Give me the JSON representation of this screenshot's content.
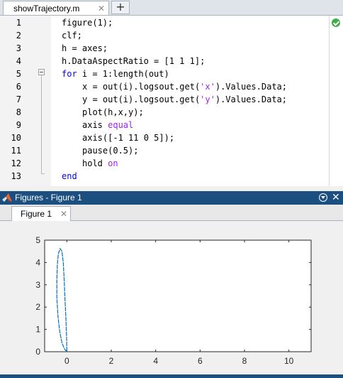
{
  "editor": {
    "tab_label": "showTrajectory.m",
    "new_tab_symbol": "+",
    "lines": [
      {
        "n": "1",
        "indent": 0,
        "parts": [
          {
            "t": "figure(1);",
            "c": "n"
          }
        ]
      },
      {
        "n": "2",
        "indent": 0,
        "parts": [
          {
            "t": "clf;",
            "c": "n"
          }
        ]
      },
      {
        "n": "3",
        "indent": 0,
        "parts": [
          {
            "t": "h = axes;",
            "c": "n"
          }
        ]
      },
      {
        "n": "4",
        "indent": 0,
        "parts": [
          {
            "t": "h.DataAspectRatio = [1 1 1];",
            "c": "n"
          }
        ]
      },
      {
        "n": "5",
        "indent": 0,
        "parts": [
          {
            "t": "for",
            "c": "k"
          },
          {
            "t": " i = 1:length(out)",
            "c": "n"
          }
        ]
      },
      {
        "n": "6",
        "indent": 1,
        "parts": [
          {
            "t": "x = out(i).logsout.get(",
            "c": "n"
          },
          {
            "t": "'x'",
            "c": "s"
          },
          {
            "t": ").Values.Data;",
            "c": "n"
          }
        ]
      },
      {
        "n": "7",
        "indent": 1,
        "parts": [
          {
            "t": "y = out(i).logsout.get(",
            "c": "n"
          },
          {
            "t": "'y'",
            "c": "s"
          },
          {
            "t": ").Values.Data;",
            "c": "n"
          }
        ]
      },
      {
        "n": "8",
        "indent": 1,
        "parts": [
          {
            "t": "plot(h,x,y);",
            "c": "n"
          }
        ]
      },
      {
        "n": "9",
        "indent": 1,
        "parts": [
          {
            "t": "axis ",
            "c": "n"
          },
          {
            "t": "equal",
            "c": "s"
          }
        ]
      },
      {
        "n": "10",
        "indent": 1,
        "parts": [
          {
            "t": "axis([-1 11 0 5]);",
            "c": "n"
          }
        ]
      },
      {
        "n": "11",
        "indent": 1,
        "parts": [
          {
            "t": "pause(0.5);",
            "c": "n"
          }
        ]
      },
      {
        "n": "12",
        "indent": 1,
        "parts": [
          {
            "t": "hold ",
            "c": "n"
          },
          {
            "t": "on",
            "c": "s"
          }
        ]
      },
      {
        "n": "13",
        "indent": 0,
        "parts": [
          {
            "t": "end",
            "c": "k"
          }
        ]
      }
    ],
    "colors": {
      "keyword": "#0000ff",
      "string": "#a020f0",
      "text": "#000000"
    },
    "status_icon": "check-circle-icon"
  },
  "figures_panel": {
    "title": "Figures - Figure 1",
    "tab_label": "Figure 1",
    "header_color": "#1a4f80"
  },
  "chart_data": {
    "type": "line",
    "title": "",
    "xlabel": "",
    "ylabel": "",
    "xlim": [
      -1,
      11
    ],
    "ylim": [
      0,
      5
    ],
    "xticks": [
      0,
      2,
      4,
      6,
      8,
      10
    ],
    "yticks": [
      0,
      1,
      2,
      3,
      4,
      5
    ],
    "grid": false,
    "line_color": "#0072bd",
    "series": [
      {
        "x": [
          0.0,
          -0.05,
          -0.12,
          -0.22,
          -0.32,
          -0.4,
          -0.45,
          -0.45,
          -0.43,
          -0.38,
          -0.3,
          -0.22,
          -0.16,
          -0.12,
          -0.08,
          -0.04,
          -0.01,
          0.0
        ],
        "y": [
          0.0,
          0.05,
          0.15,
          0.4,
          0.9,
          1.6,
          2.4,
          3.2,
          3.9,
          4.4,
          4.62,
          4.5,
          4.0,
          3.2,
          2.3,
          1.4,
          0.6,
          0.0
        ]
      }
    ]
  }
}
